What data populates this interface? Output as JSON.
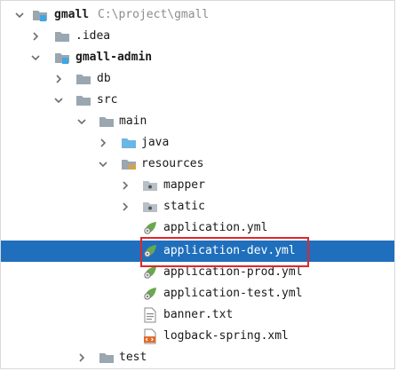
{
  "tree": {
    "project_name": "gmall",
    "project_path": "C:\\project\\gmall",
    "idea_folder": ".idea",
    "module_name": "gmall-admin",
    "db_folder": "db",
    "src_folder": "src",
    "main_folder": "main",
    "java_folder": "java",
    "resources_folder": "resources",
    "mapper_folder": "mapper",
    "static_folder": "static",
    "files": [
      "application.yml",
      "application-dev.yml",
      "application-prod.yml",
      "application-test.yml",
      "banner.txt",
      "logback-spring.xml"
    ],
    "test_folder": "test",
    "selected_file": "application-dev.yml"
  },
  "colors": {
    "selection": "#1f6fbd",
    "folder": "#9aa7b0",
    "source_folder": "#6cb6e6",
    "spring_leaf": "#6aa84f",
    "highlight_border": "#e0262a"
  }
}
